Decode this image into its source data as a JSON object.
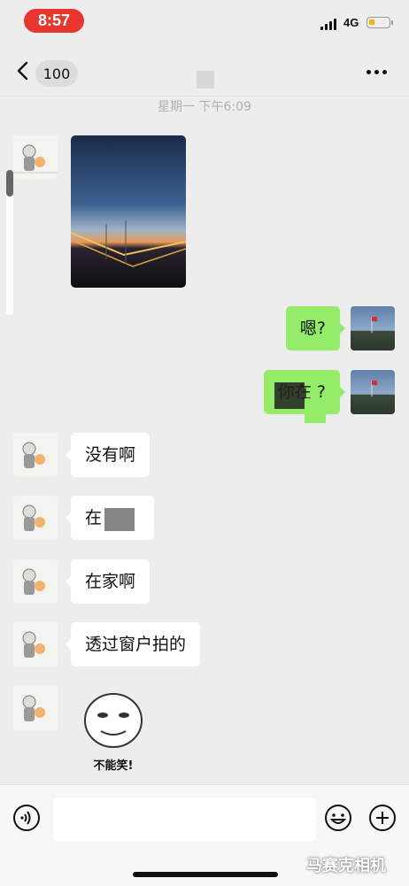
{
  "status_bar": {
    "time": "8:57",
    "network": "4G"
  },
  "nav": {
    "unread_count": "100"
  },
  "timestamp": "星期一 下午6:09",
  "messages": [
    {
      "side": "left",
      "type": "image"
    },
    {
      "side": "right",
      "type": "text",
      "text": "嗯?"
    },
    {
      "side": "right",
      "type": "text",
      "text": "你在  ?"
    },
    {
      "side": "left",
      "type": "text",
      "text": "没有啊"
    },
    {
      "side": "left",
      "type": "text",
      "text": "在  "
    },
    {
      "side": "left",
      "type": "text",
      "text": "在家啊"
    },
    {
      "side": "left",
      "type": "text",
      "text": "透过窗户拍的"
    },
    {
      "side": "left",
      "type": "sticker",
      "caption": "不能笑!"
    }
  ],
  "watermark": "马赛克相机",
  "colors": {
    "bubble_green": "#95ec69",
    "time_pill": "#e8362f",
    "background": "#ededed"
  }
}
